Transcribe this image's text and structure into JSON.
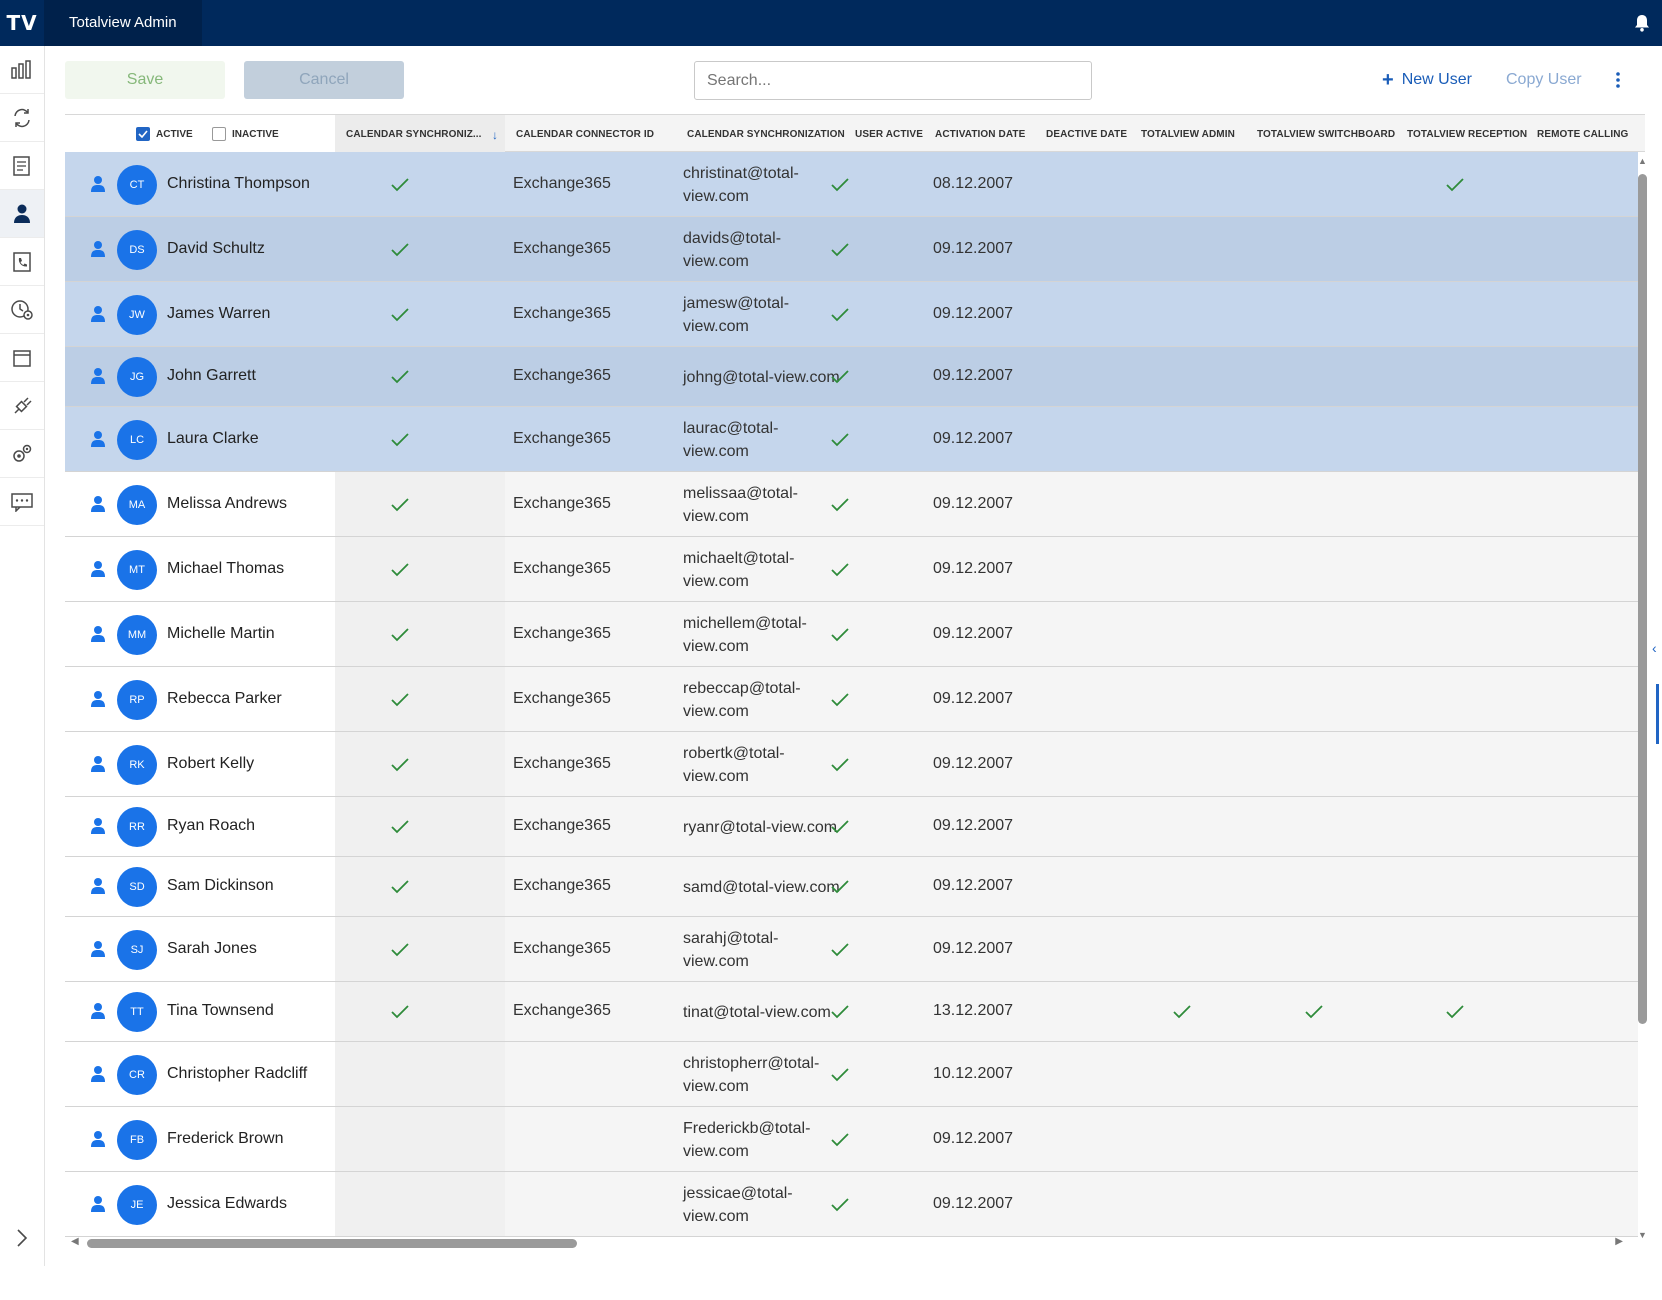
{
  "app": {
    "logo": "TV",
    "tab_title": "Totalview Admin"
  },
  "sidebar": {
    "items": [
      {
        "name": "statistics-icon",
        "active": false
      },
      {
        "name": "sync-icon",
        "active": false
      },
      {
        "name": "document-icon",
        "active": false
      },
      {
        "name": "user-icon",
        "active": true
      },
      {
        "name": "phone-book-icon",
        "active": false
      },
      {
        "name": "clock-settings-icon",
        "active": false
      },
      {
        "name": "calendar-icon",
        "active": false
      },
      {
        "name": "plug-icon",
        "active": false
      },
      {
        "name": "settings-icon",
        "active": false
      },
      {
        "name": "message-icon",
        "active": false
      }
    ]
  },
  "toolbar": {
    "save_label": "Save",
    "cancel_label": "Cancel",
    "search_placeholder": "Search...",
    "new_user_label": "New User",
    "copy_user_label": "Copy User"
  },
  "table": {
    "filters": {
      "active_label": "ACTIVE",
      "inactive_label": "INACTIVE",
      "active_checked": true,
      "inactive_checked": false
    },
    "columns": [
      "CALENDAR SYNCHRONIZ...",
      "CALENDAR CONNECTOR ID",
      "CALENDAR SYNCHRONIZATION",
      "USER ACTIVE",
      "ACTIVATION DATE",
      "DEACTIVE DATE",
      "TOTALVIEW ADMIN",
      "TOTALVIEW SWITCHBOARD",
      "TOTALVIEW RECEPTION",
      "REMOTE CALLING"
    ],
    "rows": [
      {
        "initials": "CT",
        "name": "Christina Thompson",
        "cal_sync": true,
        "connector": "Exchange365",
        "email": "christinat@total-view.com",
        "active": true,
        "activation": "08.12.2007",
        "admin": false,
        "switchboard": false,
        "reception": true
      },
      {
        "initials": "DS",
        "name": "David Schultz",
        "cal_sync": true,
        "connector": "Exchange365",
        "email": "davids@total-view.com",
        "active": true,
        "activation": "09.12.2007",
        "admin": false,
        "switchboard": false,
        "reception": false
      },
      {
        "initials": "JW",
        "name": "James Warren",
        "cal_sync": true,
        "connector": "Exchange365",
        "email": "jamesw@total-view.com",
        "active": true,
        "activation": "09.12.2007",
        "admin": false,
        "switchboard": false,
        "reception": false
      },
      {
        "initials": "JG",
        "name": "John Garrett",
        "cal_sync": true,
        "connector": "Exchange365",
        "email": "johng@total-view.com",
        "active": true,
        "activation": "09.12.2007",
        "admin": false,
        "switchboard": false,
        "reception": false
      },
      {
        "initials": "LC",
        "name": "Laura Clarke",
        "cal_sync": true,
        "connector": "Exchange365",
        "email": "laurac@total-view.com",
        "active": true,
        "activation": "09.12.2007",
        "admin": false,
        "switchboard": false,
        "reception": false
      },
      {
        "initials": "MA",
        "name": "Melissa Andrews",
        "cal_sync": true,
        "connector": "Exchange365",
        "email": "melissaa@total-view.com",
        "active": true,
        "activation": "09.12.2007",
        "admin": false,
        "switchboard": false,
        "reception": false
      },
      {
        "initials": "MT",
        "name": "Michael Thomas",
        "cal_sync": true,
        "connector": "Exchange365",
        "email": "michaelt@total-view.com",
        "active": true,
        "activation": "09.12.2007",
        "admin": false,
        "switchboard": false,
        "reception": false
      },
      {
        "initials": "MM",
        "name": "Michelle Martin",
        "cal_sync": true,
        "connector": "Exchange365",
        "email": "michellem@total-view.com",
        "active": true,
        "activation": "09.12.2007",
        "admin": false,
        "switchboard": false,
        "reception": false
      },
      {
        "initials": "RP",
        "name": "Rebecca Parker",
        "cal_sync": true,
        "connector": "Exchange365",
        "email": "rebeccap@total-view.com",
        "active": true,
        "activation": "09.12.2007",
        "admin": false,
        "switchboard": false,
        "reception": false
      },
      {
        "initials": "RK",
        "name": "Robert Kelly",
        "cal_sync": true,
        "connector": "Exchange365",
        "email": "robertk@total-view.com",
        "active": true,
        "activation": "09.12.2007",
        "admin": false,
        "switchboard": false,
        "reception": false
      },
      {
        "initials": "RR",
        "name": "Ryan Roach",
        "cal_sync": true,
        "connector": "Exchange365",
        "email": "ryanr@total-view.com",
        "active": true,
        "activation": "09.12.2007",
        "admin": false,
        "switchboard": false,
        "reception": false
      },
      {
        "initials": "SD",
        "name": "Sam Dickinson",
        "cal_sync": true,
        "connector": "Exchange365",
        "email": "samd@total-view.com",
        "active": true,
        "activation": "09.12.2007",
        "admin": false,
        "switchboard": false,
        "reception": false
      },
      {
        "initials": "SJ",
        "name": "Sarah Jones",
        "cal_sync": true,
        "connector": "Exchange365",
        "email": "sarahj@total-view.com",
        "active": true,
        "activation": "09.12.2007",
        "admin": false,
        "switchboard": false,
        "reception": false
      },
      {
        "initials": "TT",
        "name": "Tina Townsend",
        "cal_sync": true,
        "connector": "Exchange365",
        "email": "tinat@total-view.com",
        "active": true,
        "activation": "13.12.2007",
        "admin": true,
        "switchboard": true,
        "reception": true
      },
      {
        "initials": "CR",
        "name": "Christopher Radcliff",
        "cal_sync": false,
        "connector": "",
        "email": "christopherr@total-view.com",
        "active": true,
        "activation": "10.12.2007",
        "admin": false,
        "switchboard": false,
        "reception": false
      },
      {
        "initials": "FB",
        "name": "Frederick Brown",
        "cal_sync": false,
        "connector": "",
        "email": "Frederickb@total-view.com",
        "active": true,
        "activation": "09.12.2007",
        "admin": false,
        "switchboard": false,
        "reception": false
      },
      {
        "initials": "JE",
        "name": "Jessica Edwards",
        "cal_sync": false,
        "connector": "",
        "email": "jessicae@total-view.com",
        "active": true,
        "activation": "09.12.2007",
        "admin": false,
        "switchboard": false,
        "reception": false
      }
    ],
    "selected_count": 5
  },
  "colors": {
    "topbar": "#00295c",
    "accent": "#1a73e8",
    "check": "#2e8b3a",
    "selected_row": "#c5d6ec"
  }
}
